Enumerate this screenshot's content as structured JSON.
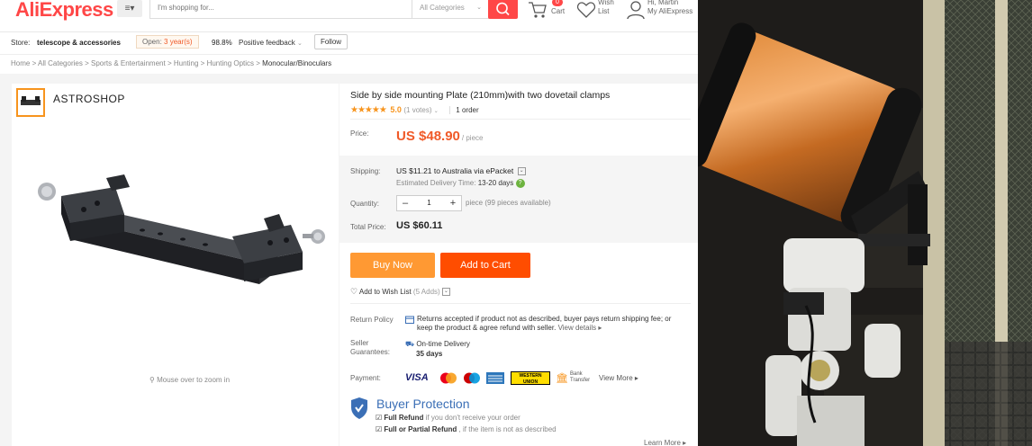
{
  "header": {
    "logo": "AliExpress",
    "menu_label": "≡▾",
    "search_placeholder": "I'm shopping for...",
    "search_category": "All Categories",
    "cart_count": "0",
    "cart_label": "Cart",
    "wish_line1": "Wish",
    "wish_line2": "List",
    "account_line1": "Hi, Martin",
    "account_line2": "My AliExpress"
  },
  "store": {
    "label": "Store:",
    "name": "telescope & accessories",
    "open_prefix": "Open:",
    "open_years": "3 year(s)",
    "feedback_pct": "98.8%",
    "feedback_label": "Positive feedback",
    "follow": "Follow"
  },
  "breadcrumb": [
    "Home",
    "All Categories",
    "Sports & Entertainment",
    "Hunting",
    "Hunting Optics",
    "Monocular/Binoculars"
  ],
  "breadcrumb_sep": ">",
  "gallery": {
    "brand": "ASTROSHOP",
    "zoom_hint": "Mouse over to zoom in"
  },
  "product": {
    "title": "Side by side mounting Plate (210mm)with two dovetail clamps",
    "stars": "★★★★★",
    "score": "5.0",
    "votes": "(1 votes)",
    "orders": "1 order",
    "price_label": "Price:",
    "price": "US $48.90",
    "price_unit": "/ piece",
    "shipping_label": "Shipping:",
    "shipping_text": "US $11.21 to Australia via ePacket",
    "eta_label": "Estimated Delivery Time:",
    "eta_value": "13-20 days",
    "quantity_label": "Quantity:",
    "quantity": "1",
    "quantity_avail": "piece (99 pieces available)",
    "total_label": "Total Price:",
    "total": "US $60.11",
    "buy_now": "Buy Now",
    "add_to_cart": "Add to Cart",
    "wishlist": "Add to Wish List",
    "wishlist_count": "(5 Adds)"
  },
  "policy": {
    "return_label": "Return Policy",
    "return_text": "Returns accepted if product not as described, buyer pays return shipping fee; or keep the product & agree refund with seller.",
    "view_details": "View details",
    "seller_label1": "Seller",
    "seller_label2": "Guarantees:",
    "ontime": "On-time Delivery",
    "ontime_days": "35 days",
    "payment_label": "Payment:",
    "view_more": "View More",
    "bank_line1": "Bank",
    "bank_line2": "Transfer",
    "visa": "VISA",
    "wu": "WESTERN UNION"
  },
  "protection": {
    "title": "Buyer Protection",
    "line1_bold": "Full Refund",
    "line1_rest": "if you don't receive your order",
    "line2_bold": "Full or Partial Refund",
    "line2_rest": ", if the item is not as described",
    "learn_more": "Learn More"
  },
  "colors": {
    "accent": "#ff4747",
    "price": "#f05a28",
    "buy_now": "#ff9933",
    "add_to_cart": "#ff4d00",
    "protection": "#3b6fb6"
  }
}
